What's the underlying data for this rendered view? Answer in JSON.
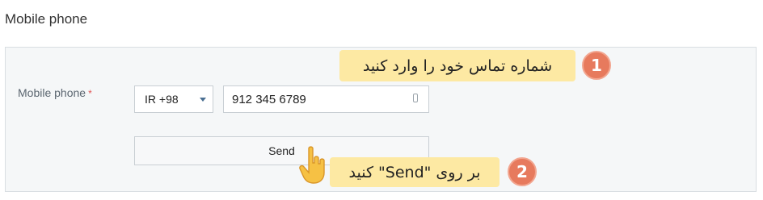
{
  "section": {
    "title": "Mobile phone"
  },
  "form": {
    "label": "Mobile phone",
    "required_marker": "*",
    "country_code": "IR +98",
    "phone_value": "912 345 6789",
    "send_label": "Send"
  },
  "annotations": {
    "step1_number": "1",
    "step1_text": "شماره تماس خود را وارد کنید",
    "step2_number": "2",
    "step2_text": "بر روی \"Send\" کنید"
  },
  "icons": {
    "phone": "mobile-phone-icon",
    "dropdown": "caret-down-icon",
    "pointer": "hand-pointer-icon"
  },
  "colors": {
    "callout_bg": "#fde9a3",
    "badge": "#e77a5d",
    "panel_bg": "#f5f7f8",
    "caret": "#4a6f92"
  }
}
